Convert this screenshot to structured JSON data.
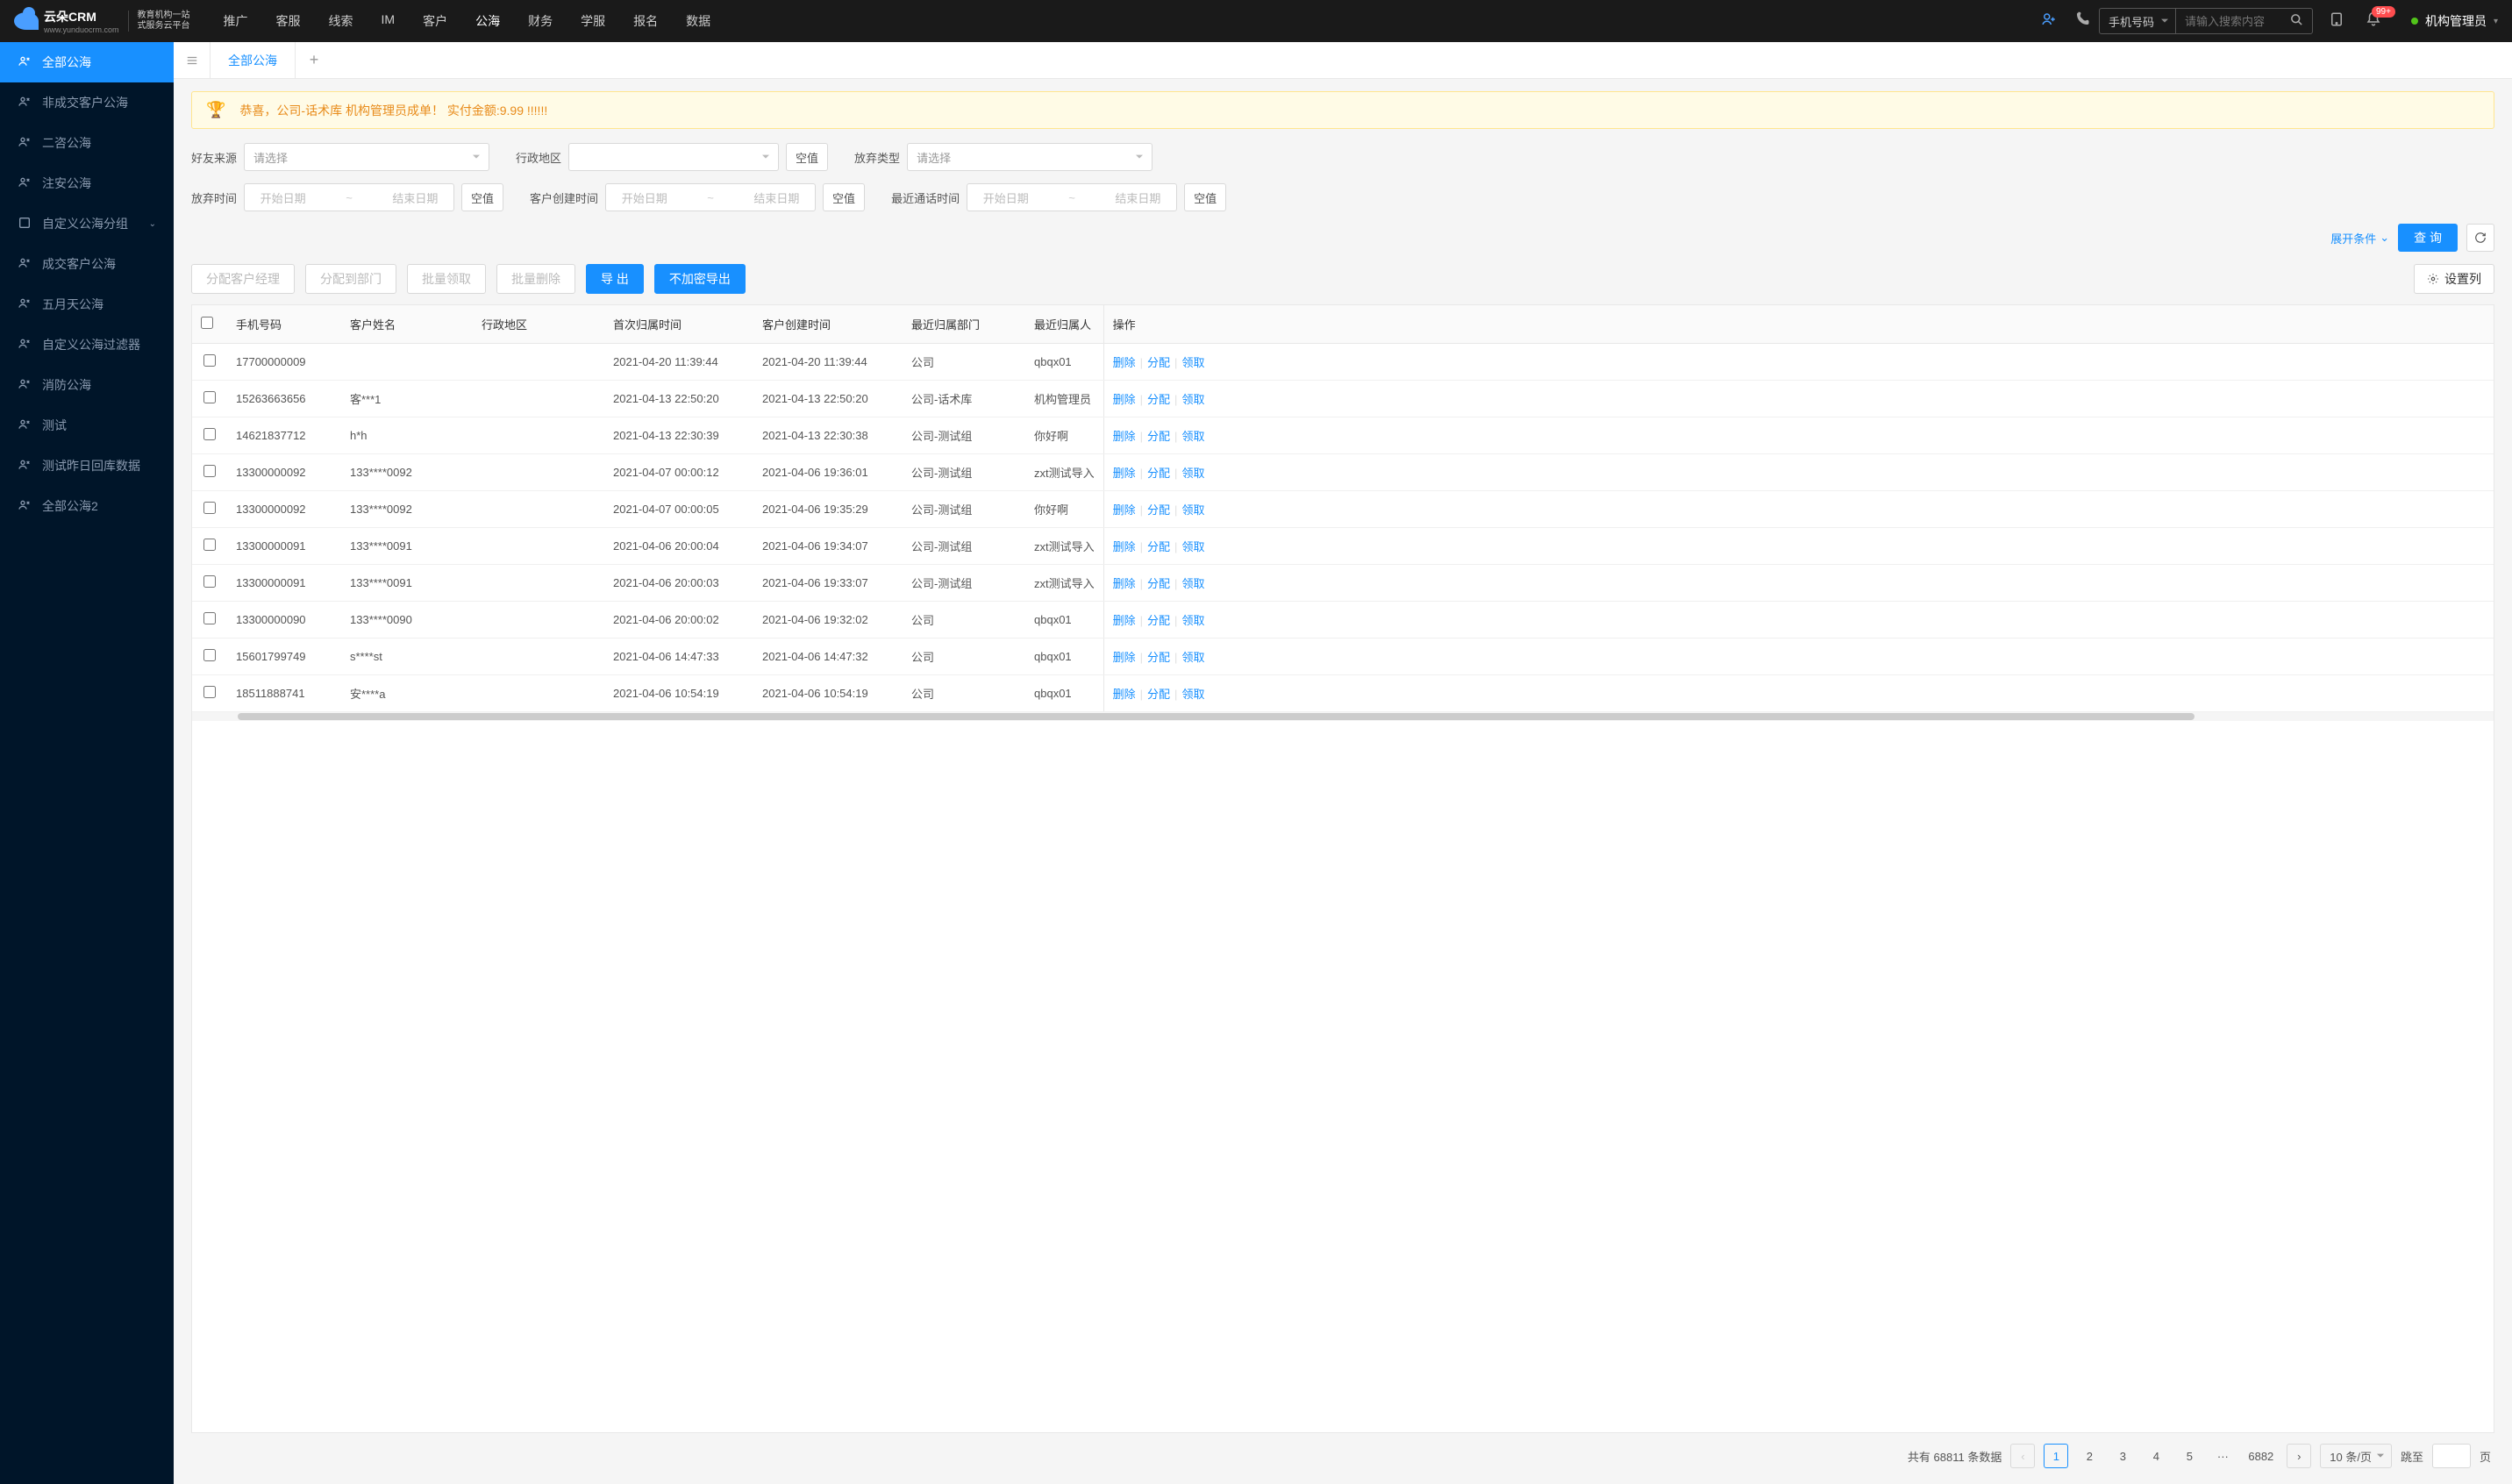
{
  "logo": {
    "main": "云朵CRM",
    "sub": "www.yunduocrm.com",
    "tagline1": "教育机构一站",
    "tagline2": "式服务云平台"
  },
  "nav": [
    "推广",
    "客服",
    "线索",
    "IM",
    "客户",
    "公海",
    "财务",
    "学服",
    "报名",
    "数据"
  ],
  "nav_active": 5,
  "search": {
    "type": "手机号码",
    "placeholder": "请输入搜索内容"
  },
  "badge": "99+",
  "user": "机构管理员",
  "sidebar": [
    {
      "label": "全部公海",
      "active": true
    },
    {
      "label": "非成交客户公海"
    },
    {
      "label": "二咨公海"
    },
    {
      "label": "注安公海"
    },
    {
      "label": "自定义公海分组",
      "expandable": true
    },
    {
      "label": "成交客户公海"
    },
    {
      "label": "五月天公海"
    },
    {
      "label": "自定义公海过滤器"
    },
    {
      "label": "消防公海"
    },
    {
      "label": "测试"
    },
    {
      "label": "测试昨日回库数据"
    },
    {
      "label": "全部公海2"
    }
  ],
  "tab": "全部公海",
  "banner": "恭喜，公司-话术库  机构管理员成单！  实付金额:9.99 !!!!!!",
  "filters": {
    "friend_source": {
      "label": "好友来源",
      "placeholder": "请选择"
    },
    "region": {
      "label": "行政地区"
    },
    "abandon_type": {
      "label": "放弃类型",
      "placeholder": "请选择"
    },
    "abandon_time": {
      "label": "放弃时间",
      "start": "开始日期",
      "end": "结束日期"
    },
    "create_time": {
      "label": "客户创建时间",
      "start": "开始日期",
      "end": "结束日期"
    },
    "call_time": {
      "label": "最近通话时间",
      "start": "开始日期",
      "end": "结束日期"
    },
    "empty": "空值",
    "expand": "展开条件",
    "query": "查 询"
  },
  "toolbar": {
    "assign_manager": "分配客户经理",
    "assign_dept": "分配到部门",
    "batch_claim": "批量领取",
    "batch_delete": "批量删除",
    "export": "导 出",
    "export_raw": "不加密导出",
    "columns": "设置列"
  },
  "columns": [
    "手机号码",
    "客户姓名",
    "行政地区",
    "首次归属时间",
    "客户创建时间",
    "最近归属部门",
    "最近归属人",
    "操作"
  ],
  "actions": {
    "delete": "删除",
    "assign": "分配",
    "claim": "领取"
  },
  "rows": [
    {
      "phone": "17700000009",
      "name": "",
      "region": "",
      "first_time": "2021-04-20 11:39:44",
      "create_time": "2021-04-20 11:39:44",
      "dept": "公司",
      "owner": "qbqx01"
    },
    {
      "phone": "15263663656",
      "name": "客***1",
      "region": "",
      "first_time": "2021-04-13 22:50:20",
      "create_time": "2021-04-13 22:50:20",
      "dept": "公司-话术库",
      "owner": "机构管理员"
    },
    {
      "phone": "14621837712",
      "name": "h*h",
      "region": "",
      "first_time": "2021-04-13 22:30:39",
      "create_time": "2021-04-13 22:30:38",
      "dept": "公司-测试组",
      "owner": "你好啊"
    },
    {
      "phone": "13300000092",
      "name": "133****0092",
      "region": "",
      "first_time": "2021-04-07 00:00:12",
      "create_time": "2021-04-06 19:36:01",
      "dept": "公司-测试组",
      "owner": "zxt测试导入"
    },
    {
      "phone": "13300000092",
      "name": "133****0092",
      "region": "",
      "first_time": "2021-04-07 00:00:05",
      "create_time": "2021-04-06 19:35:29",
      "dept": "公司-测试组",
      "owner": "你好啊"
    },
    {
      "phone": "13300000091",
      "name": "133****0091",
      "region": "",
      "first_time": "2021-04-06 20:00:04",
      "create_time": "2021-04-06 19:34:07",
      "dept": "公司-测试组",
      "owner": "zxt测试导入"
    },
    {
      "phone": "13300000091",
      "name": "133****0091",
      "region": "",
      "first_time": "2021-04-06 20:00:03",
      "create_time": "2021-04-06 19:33:07",
      "dept": "公司-测试组",
      "owner": "zxt测试导入"
    },
    {
      "phone": "13300000090",
      "name": "133****0090",
      "region": "",
      "first_time": "2021-04-06 20:00:02",
      "create_time": "2021-04-06 19:32:02",
      "dept": "公司",
      "owner": "qbqx01"
    },
    {
      "phone": "15601799749",
      "name": "s****st",
      "region": "",
      "first_time": "2021-04-06 14:47:33",
      "create_time": "2021-04-06 14:47:32",
      "dept": "公司",
      "owner": "qbqx01"
    },
    {
      "phone": "18511888741",
      "name": "安****a",
      "region": "",
      "first_time": "2021-04-06 10:54:19",
      "create_time": "2021-04-06 10:54:19",
      "dept": "公司",
      "owner": "qbqx01"
    }
  ],
  "pagination": {
    "total_prefix": "共有",
    "total": "68811",
    "total_suffix": "条数据",
    "pages": [
      "1",
      "2",
      "3",
      "4",
      "5"
    ],
    "ellipsis": "···",
    "last": "6882",
    "size": "10 条/页",
    "jump_label": "跳至",
    "jump_suffix": "页"
  }
}
